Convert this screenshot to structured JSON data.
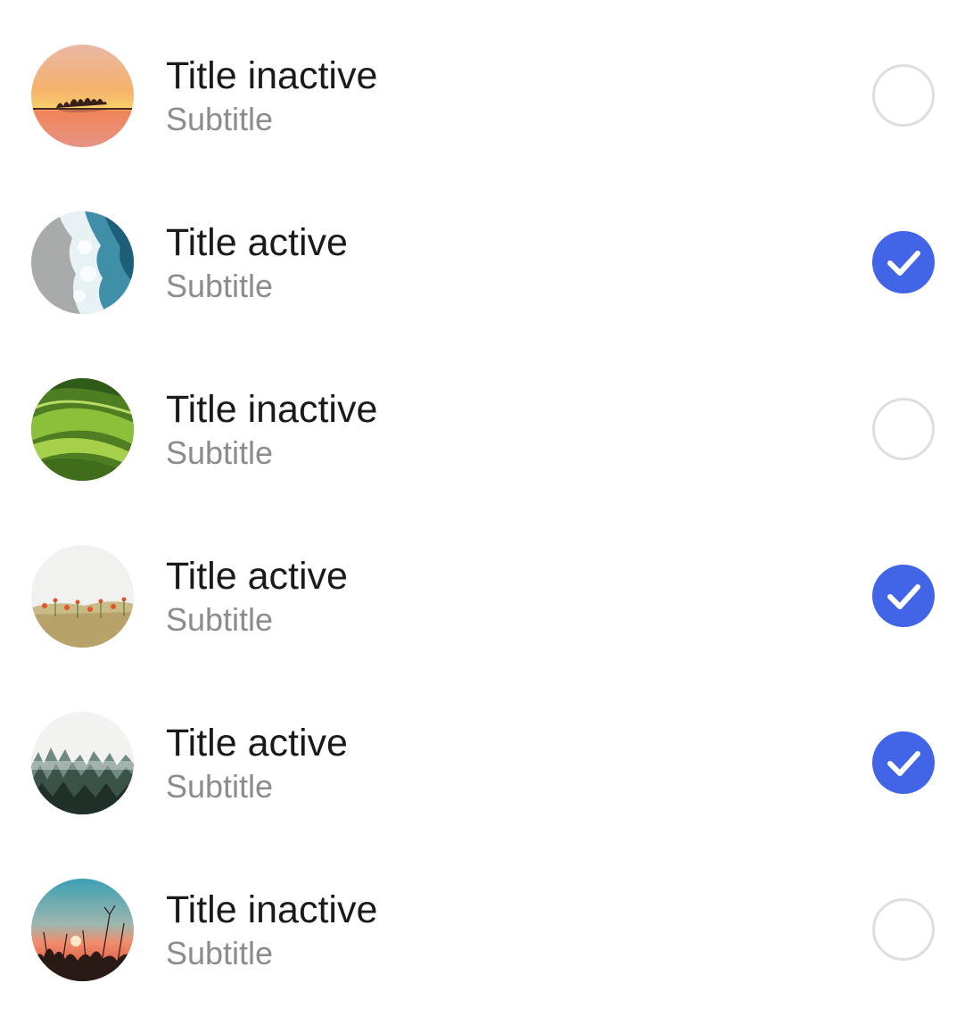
{
  "accent_color": "#4264e6",
  "items": [
    {
      "title": "Title inactive",
      "subtitle": "Subtitle",
      "selected": false,
      "thumbnail": "sunset-lake-island"
    },
    {
      "title": "Title active",
      "subtitle": "Subtitle",
      "selected": true,
      "thumbnail": "ocean-wave-shore"
    },
    {
      "title": "Title inactive",
      "subtitle": "Subtitle",
      "selected": false,
      "thumbnail": "green-tea-hills"
    },
    {
      "title": "Title active",
      "subtitle": "Subtitle",
      "selected": true,
      "thumbnail": "wildflower-meadow"
    },
    {
      "title": "Title active",
      "subtitle": "Subtitle",
      "selected": true,
      "thumbnail": "misty-pine-forest"
    },
    {
      "title": "Title inactive",
      "subtitle": "Subtitle",
      "selected": false,
      "thumbnail": "sunrise-grass-silhouette"
    }
  ]
}
